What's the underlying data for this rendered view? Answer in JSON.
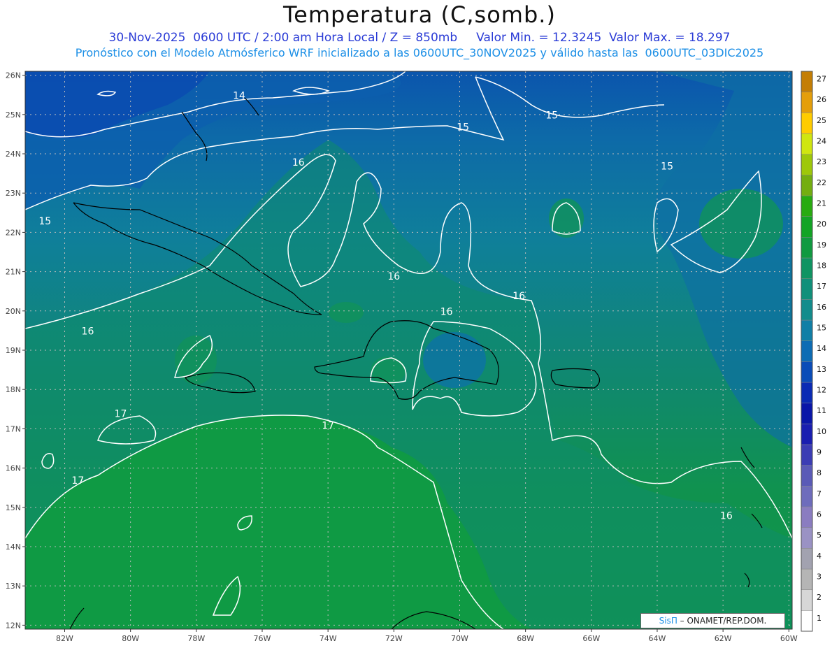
{
  "title": "Temperatura (C,somb.)",
  "subtitle1": "30-Nov-2025  0600 UTC / 2:00 am Hora Local / Z = 850mb     Valor Min. = 12.3245  Valor Max. = 18.297",
  "subtitle2": "Pronóstico con el Modelo Atmósferico WRF inicializado a las 0600UTC_30NOV2025 y válido hasta las  0600UTC_03DIC2025",
  "credit": {
    "brand": "SisΠ",
    "text": " – ONAMET/REP.DOM."
  },
  "map": {
    "lon_range": [
      -83.2,
      -59.9
    ],
    "lat_range": [
      11.9,
      26.1
    ],
    "lon_ticks": [
      "82W",
      "80W",
      "78W",
      "76W",
      "74W",
      "72W",
      "70W",
      "68W",
      "66W",
      "64W",
      "62W",
      "60W"
    ],
    "lat_ticks": [
      "12N",
      "13N",
      "14N",
      "15N",
      "16N",
      "17N",
      "18N",
      "19N",
      "20N",
      "21N",
      "22N",
      "23N",
      "24N",
      "25N",
      "26N"
    ],
    "contour_labels": [
      {
        "text": "14",
        "lon": -76.7,
        "lat": 25.4
      },
      {
        "text": "15",
        "lon": -69.9,
        "lat": 24.6
      },
      {
        "text": "15",
        "lon": -67.2,
        "lat": 24.9
      },
      {
        "text": "15",
        "lon": -63.7,
        "lat": 23.6
      },
      {
        "text": "15",
        "lon": -82.6,
        "lat": 22.2
      },
      {
        "text": "16",
        "lon": -74.9,
        "lat": 23.7
      },
      {
        "text": "16",
        "lon": -72.0,
        "lat": 20.8
      },
      {
        "text": "16",
        "lon": -68.2,
        "lat": 20.3
      },
      {
        "text": "16",
        "lon": -70.4,
        "lat": 19.9
      },
      {
        "text": "16",
        "lon": -81.3,
        "lat": 19.4
      },
      {
        "text": "16",
        "lon": -61.9,
        "lat": 14.7
      },
      {
        "text": "17",
        "lon": -80.3,
        "lat": 17.3
      },
      {
        "text": "17",
        "lon": -74.0,
        "lat": 17.0
      },
      {
        "text": "17",
        "lon": -81.6,
        "lat": 15.6
      }
    ]
  },
  "colorbar": {
    "labels": [
      "1",
      "2",
      "3",
      "4",
      "5",
      "6",
      "7",
      "8",
      "9",
      "10",
      "11",
      "12",
      "13",
      "14",
      "15",
      "16",
      "17",
      "18",
      "19",
      "20",
      "21",
      "22",
      "23",
      "24",
      "25",
      "26",
      "27"
    ],
    "colors": [
      "#ffffff",
      "#d7d7d7",
      "#b5b5b5",
      "#a2a2b0",
      "#9a92c4",
      "#8a7cc0",
      "#6e6cbc",
      "#5a5ab7",
      "#3b3cb4",
      "#1a1eb0",
      "#0a16a8",
      "#0a2ab4",
      "#0a4cb8",
      "#0d6cb4",
      "#107fa6",
      "#128c8c",
      "#10907a",
      "#0f9462",
      "#109a40",
      "#12a425",
      "#28ab10",
      "#74ae10",
      "#9ec80a",
      "#d0e610",
      "#ffcc00",
      "#e49e0a",
      "#c47e04"
    ]
  }
}
